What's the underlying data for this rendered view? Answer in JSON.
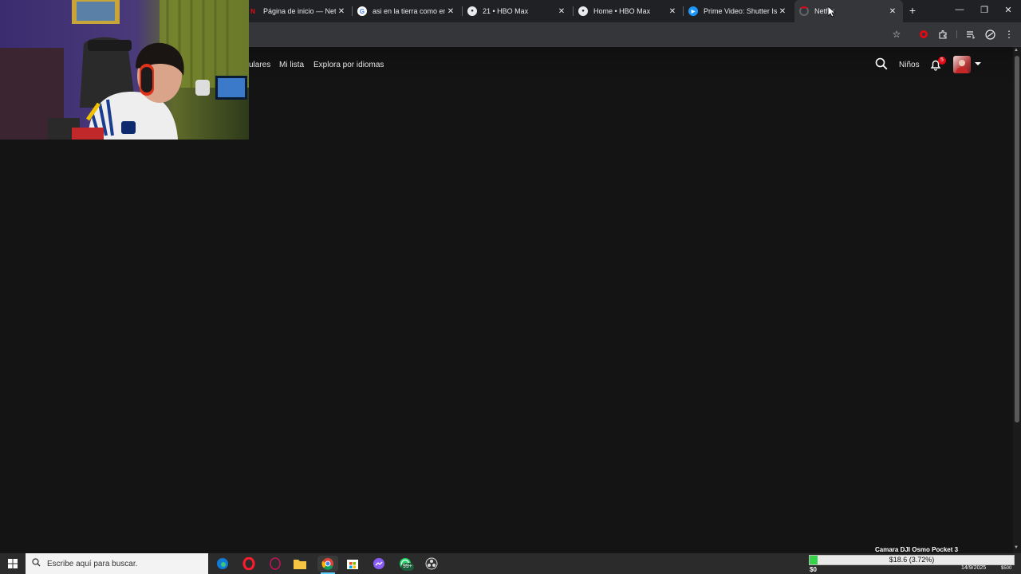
{
  "browser": {
    "tabs": [
      {
        "title": "Página de inicio — Netflix",
        "favicon": "netflix-icon",
        "color": "#e50914",
        "glyph": "N"
      },
      {
        "title": "asi en la tierra como en el",
        "favicon": "google-icon",
        "color": "#ffffff",
        "glyph": "G"
      },
      {
        "title": "21 • HBO Max",
        "favicon": "hbo-icon",
        "color": "#ffffff",
        "glyph": "●"
      },
      {
        "title": "Home • HBO Max",
        "favicon": "hbo-icon",
        "color": "#ffffff",
        "glyph": "●"
      },
      {
        "title": "Prime Video: Shutter Island",
        "favicon": "prime-video-icon",
        "color": "#1a98ff",
        "glyph": "▶"
      },
      {
        "title": "Netflix",
        "favicon": "loading-spinner-icon",
        "color": "#e50914",
        "glyph": ""
      }
    ],
    "active_tab": 5,
    "new_tab": "+",
    "window_controls": {
      "minimize": "—",
      "restore": "❐",
      "close": "✕"
    }
  },
  "netflix": {
    "nav": {
      "populares": "ulares",
      "mi_lista": "Mi lista",
      "idiomas": "Explora por idiomas"
    },
    "kids": "Niños",
    "notifications_count": "5",
    "accent": "#e50914"
  },
  "taskbar": {
    "search_placeholder": "Escribe aquí para buscar.",
    "whatsapp_badge": "99+",
    "date": "14/9/2025"
  },
  "stream_overlay": {
    "label": "Camara DJI Osmo Pocket 3",
    "goal_text": "$18.6 (3.72%)",
    "goal_fraction": 0.0372,
    "min": "$0",
    "max": "$500"
  }
}
